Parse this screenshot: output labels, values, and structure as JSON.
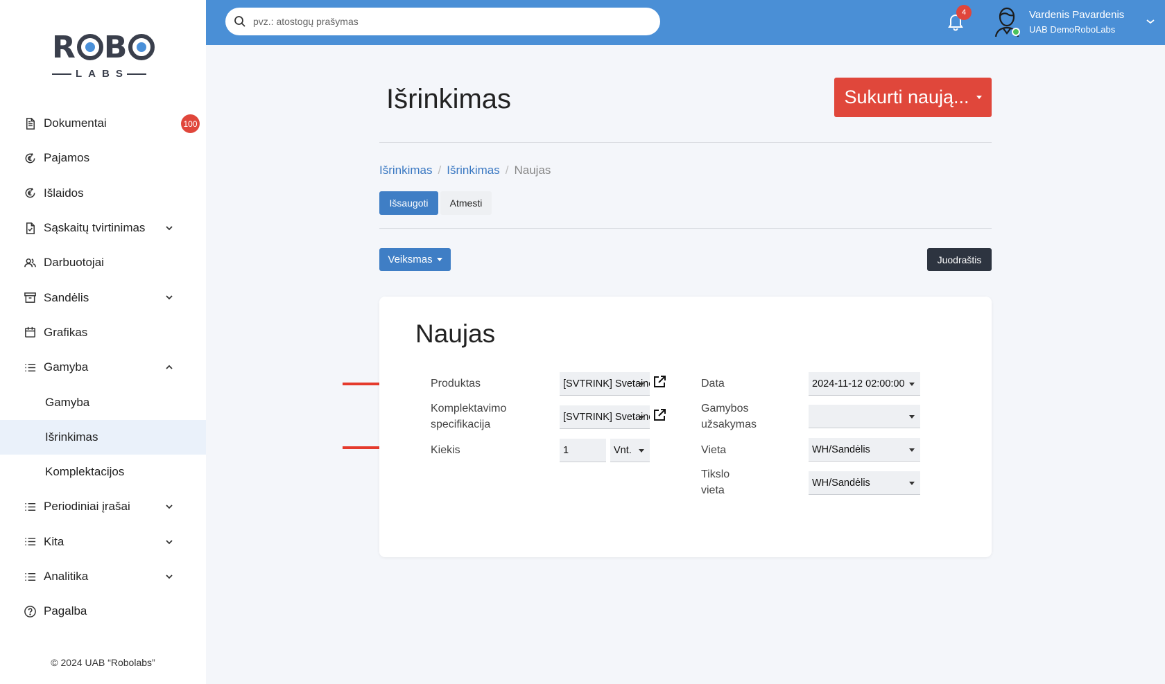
{
  "sidebar": {
    "logo_top": "ROBO",
    "logo_bottom": "LABS",
    "items": [
      {
        "label": "Dokumentai",
        "badge": "100"
      },
      {
        "label": "Pajamos"
      },
      {
        "label": "Išlaidos"
      },
      {
        "label": "Sąskaitų tvirtinimas"
      },
      {
        "label": "Darbuotojai"
      },
      {
        "label": "Sandėlis"
      },
      {
        "label": "Grafikas"
      },
      {
        "label": "Gamyba"
      },
      {
        "label": "Gamyba"
      },
      {
        "label": "Išrinkimas"
      },
      {
        "label": "Komplektacijos"
      },
      {
        "label": "Periodiniai įrašai"
      },
      {
        "label": "Kita"
      },
      {
        "label": "Analitika"
      },
      {
        "label": "Pagalba"
      }
    ],
    "copyright": "© 2024 UAB “Robolabs”"
  },
  "topbar": {
    "search_placeholder": "pvz.: atostogų prašymas",
    "notifications_count": "4",
    "user_name": "Vardenis Pavardenis",
    "user_company": "UAB DemoRoboLabs"
  },
  "main": {
    "title": "Išrinkimas",
    "create_button": "Sukurti naują...",
    "breadcrumb": [
      "Išrinkimas",
      "Išrinkimas",
      "Naujas"
    ],
    "breadcrumb_sep": "/",
    "save_button": "Išsaugoti",
    "cancel_button": "Atmesti",
    "action_button": "Veiksmas",
    "draft_button": "Juodraštis"
  },
  "form": {
    "title": "Naujas",
    "product_label": "Produktas",
    "product_value": "[SVTRINK] Svetainės",
    "bom_label_1": "Komplektavimo",
    "bom_label_2": "specifikacija",
    "bom_value": "[SVTRINK] Svetainės",
    "qty_label": "Kiekis",
    "qty_value": "1",
    "uom_value": "Vnt.",
    "date_label": "Data",
    "date_value": "2024-11-12 02:00:00",
    "order_label_1": "Gamybos",
    "order_label_2": "užsakymas",
    "order_value": "",
    "location_label": "Vieta",
    "location_value": "WH/Sandėlis",
    "dest_label_1": "Tikslo",
    "dest_label_2": "vieta",
    "dest_value": "WH/Sandėlis"
  },
  "colors": {
    "topbar": "#4a8fd6",
    "primary": "#3f7ec5",
    "danger": "#e0473b",
    "dark": "#2d3440",
    "arrow": "#e53a2c"
  }
}
